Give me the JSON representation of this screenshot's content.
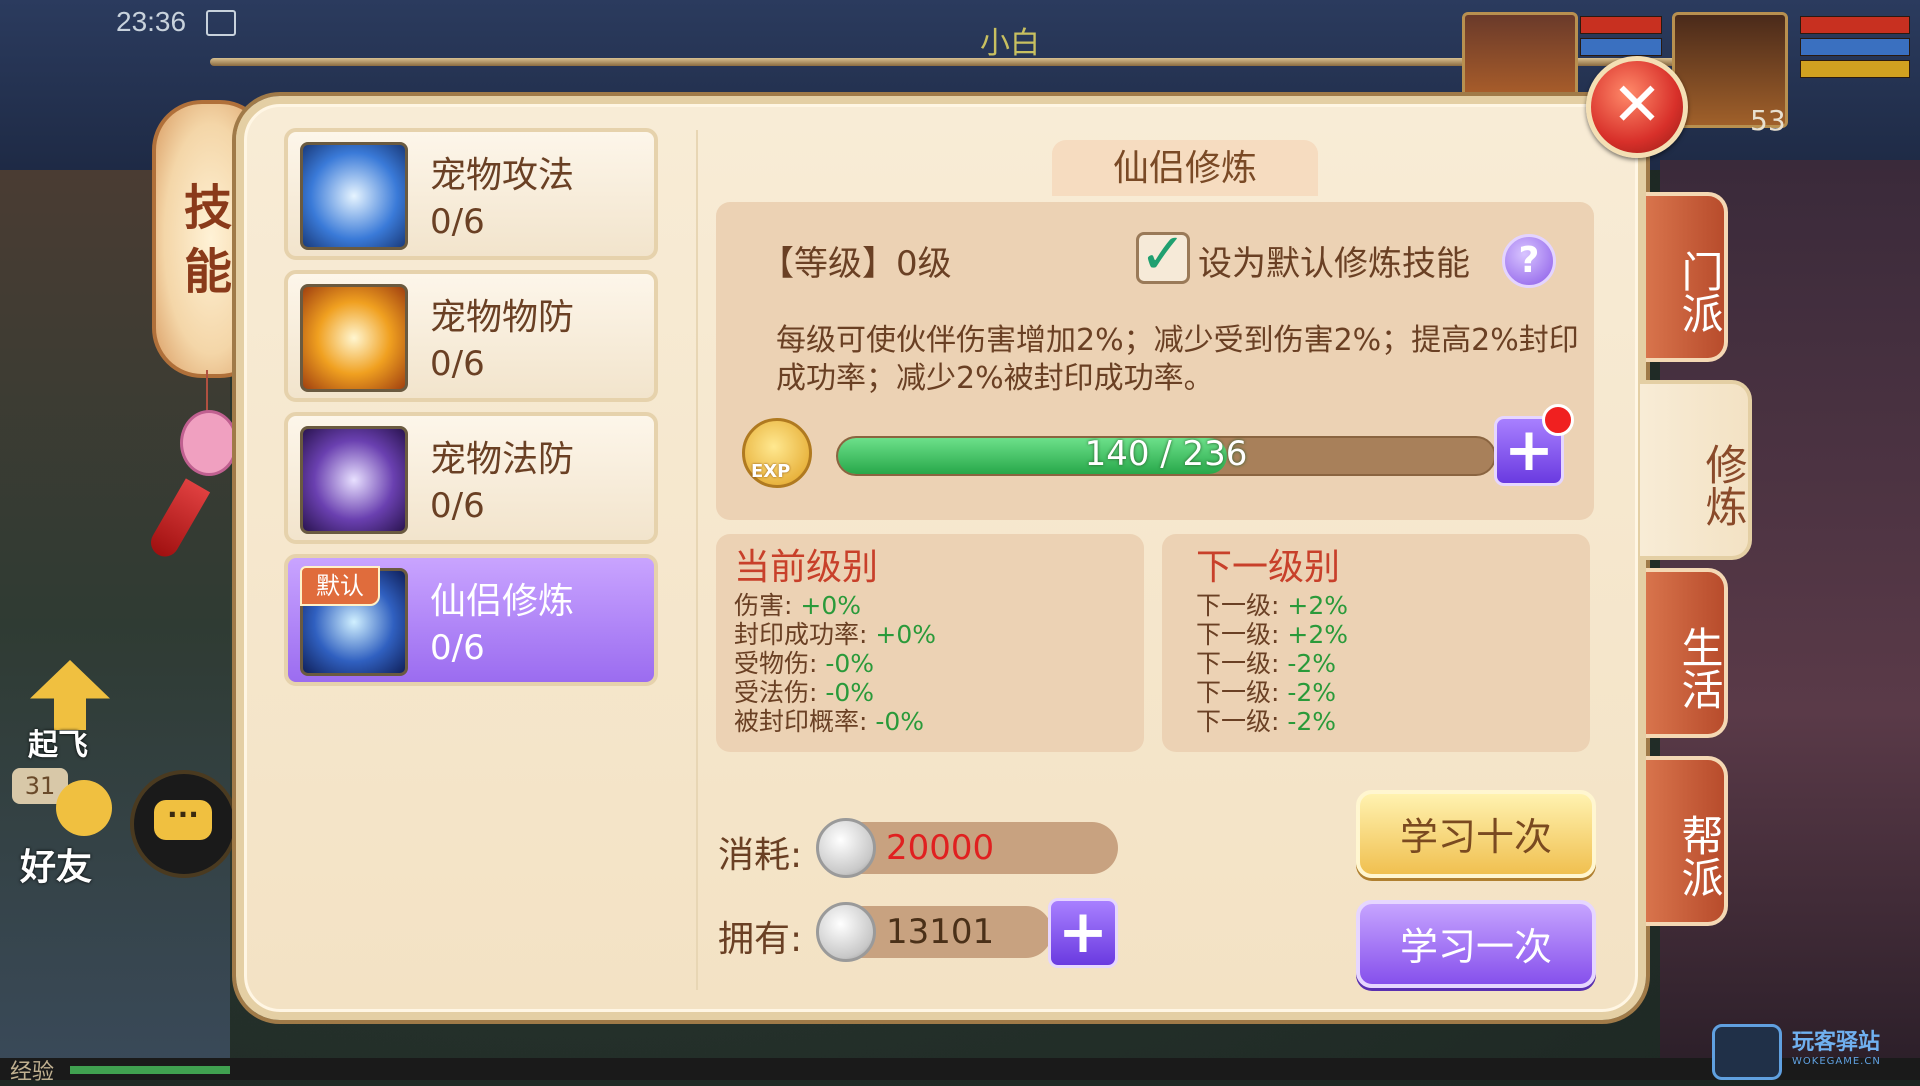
{
  "status": {
    "time": "23:36"
  },
  "player": {
    "name": "小白",
    "level": "53"
  },
  "hud": {
    "lantern_chars": [
      "技",
      "能"
    ],
    "fly_label": "起飞",
    "friend_badge": "31",
    "friend_label": "好友",
    "chat_icon": "···",
    "exp_label": "经验"
  },
  "watermark": {
    "text": "玩客驿站",
    "sub": "WOKEGAME.CN"
  },
  "skills": [
    {
      "name": "宠物攻法",
      "count": "0/6",
      "active": false,
      "tag": ""
    },
    {
      "name": "宠物物防",
      "count": "0/6",
      "active": false,
      "tag": ""
    },
    {
      "name": "宠物法防",
      "count": "0/6",
      "active": false,
      "tag": ""
    },
    {
      "name": "仙侣修炼",
      "count": "0/6",
      "active": true,
      "tag": "默认"
    }
  ],
  "detail": {
    "title": "仙侣修炼",
    "level_text": "【等级】0级",
    "default_checkbox_label": "设为默认修炼技能",
    "help_icon": "?",
    "description": "每级可使伙伴伤害增加2%；减少受到伤害2%；提高2%封印成功率；减少2%被封印成功率。",
    "exp_badge": "EXP",
    "progress": {
      "current": 140,
      "max": 236,
      "text": "140 / 236"
    }
  },
  "current_level": {
    "title": "当前级别",
    "stats": [
      {
        "label": "伤害: ",
        "value": "+0%"
      },
      {
        "label": "封印成功率: ",
        "value": "+0%"
      },
      {
        "label": "受物伤: ",
        "value": "-0%"
      },
      {
        "label": "受法伤: ",
        "value": "-0%"
      },
      {
        "label": "被封印概率: ",
        "value": "-0%"
      }
    ]
  },
  "next_level": {
    "title": "下一级别",
    "stats": [
      {
        "label": "下一级: ",
        "value": "+2%"
      },
      {
        "label": "下一级: ",
        "value": "+2%"
      },
      {
        "label": "下一级: ",
        "value": "-2%"
      },
      {
        "label": "下一级: ",
        "value": "-2%"
      },
      {
        "label": "下一级: ",
        "value": "-2%"
      }
    ]
  },
  "cost": {
    "label": "消耗:",
    "value": "20000",
    "color": "#e02020"
  },
  "owned": {
    "label": "拥有:",
    "value": "13101",
    "color": "#4a3018"
  },
  "buttons": {
    "learn_ten": "学习十次",
    "learn_one": "学习一次",
    "close": "✕",
    "plus": "+"
  },
  "side_tabs": [
    {
      "label": "门派",
      "active": false
    },
    {
      "label": "修炼",
      "active": true
    },
    {
      "label": "生活",
      "active": false
    },
    {
      "label": "帮派",
      "active": false
    }
  ]
}
